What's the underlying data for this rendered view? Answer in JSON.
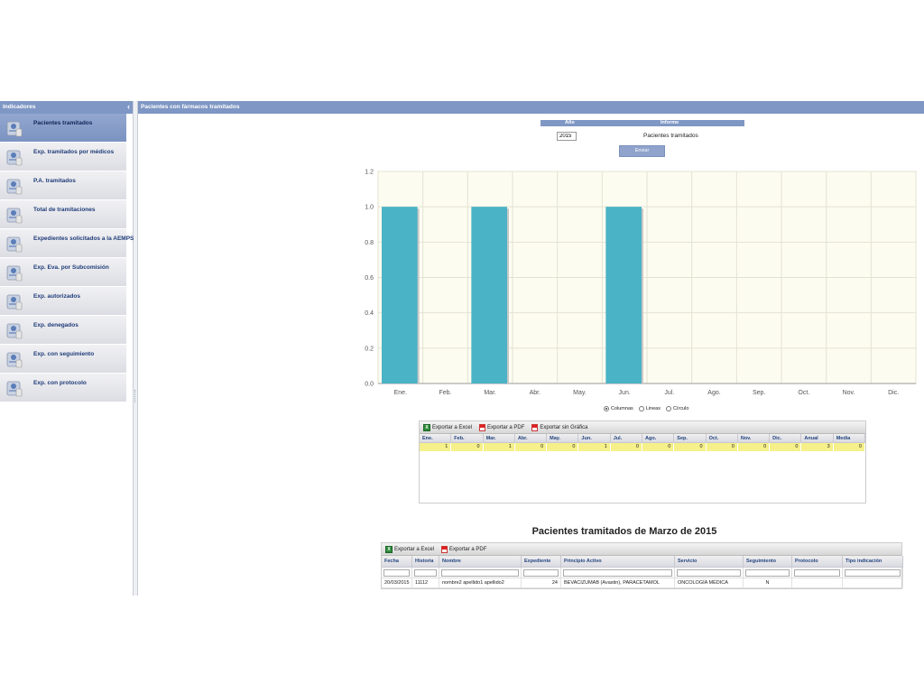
{
  "sidebar": {
    "title": "Indicadores",
    "collapse_glyph": "‹",
    "items": [
      {
        "label": "Pacientes tramitados",
        "icon": "patients-icon",
        "active": true
      },
      {
        "label": "Exp. tramitados por médicos",
        "icon": "doctors-icon"
      },
      {
        "label": "P.A. tramitados",
        "icon": "medicine-icon"
      },
      {
        "label": "Total de tramitaciones",
        "icon": "clipboard-icon"
      },
      {
        "label": "Expedientes solicitados a la AEMPS",
        "icon": "request-icon"
      },
      {
        "label": "Exp. Eva. por Subcomisión",
        "icon": "evaluation-icon"
      },
      {
        "label": "Exp. autorizados",
        "icon": "approved-icon"
      },
      {
        "label": "Exp. denegados",
        "icon": "denied-icon"
      },
      {
        "label": "Exp. con seguimiento",
        "icon": "followup-icon"
      },
      {
        "label": "Exp. con protocolo",
        "icon": "protocol-icon"
      }
    ]
  },
  "main": {
    "title": "Pacientes con fármacos tramitados",
    "form": {
      "year_label": "Año",
      "informe_label": "Informe",
      "year_value": "2015",
      "informe_value": "Pacientes tramitados",
      "submit_label": "Enviar"
    },
    "chart_options": [
      {
        "label": "Columnas",
        "selected": true
      },
      {
        "label": "Lineas",
        "selected": false
      },
      {
        "label": "Círculo",
        "selected": false
      }
    ],
    "monthly_table": {
      "toolbar": [
        "Exportar a Excel",
        "Exportar a PDF",
        "Exportar sin Gráfica"
      ],
      "headers": [
        "Ene.",
        "Feb.",
        "Mar.",
        "Abr.",
        "May.",
        "Jun.",
        "Jul.",
        "Ago.",
        "Sep.",
        "Oct.",
        "Nov.",
        "Dic.",
        "Anual",
        "Media"
      ],
      "row": [
        "1",
        "0",
        "1",
        "0",
        "0",
        "1",
        "0",
        "0",
        "0",
        "0",
        "0",
        "0",
        "3",
        "0"
      ]
    },
    "detail": {
      "title": "Pacientes tramitados de Marzo de 2015",
      "toolbar": [
        "Exportar a Excel",
        "Exportar a PDF"
      ],
      "headers": [
        "Fecha",
        "Historia",
        "Nombre",
        "Expediente",
        "Principio Activo",
        "Servicio",
        "Seguimiento",
        "Protocolo",
        "Tipo indicación"
      ],
      "rows": [
        [
          "20/03/2015",
          "11112",
          "nombre2 apellido1 apellido2",
          "24",
          "BEVACIZUMAB (Avastin), PARACETAMOL",
          "ONCOLOGÍA MÉDICA",
          "N",
          "",
          ""
        ]
      ]
    }
  },
  "chart_data": {
    "type": "bar",
    "categories": [
      "Ene.",
      "Feb.",
      "Mar.",
      "Abr.",
      "May.",
      "Jun.",
      "Jul.",
      "Ago.",
      "Sep.",
      "Oct.",
      "Nov.",
      "Dic."
    ],
    "values": [
      1,
      0,
      1,
      0,
      0,
      1,
      0,
      0,
      0,
      0,
      0,
      0
    ],
    "yticks": [
      "0.0",
      "0.2",
      "0.4",
      "0.6",
      "0.8",
      "1.0",
      "1.2"
    ],
    "ylim": [
      0,
      1.2
    ],
    "grid": true,
    "bar_color": "#4ab3c6",
    "background": "#fdfcf1"
  }
}
